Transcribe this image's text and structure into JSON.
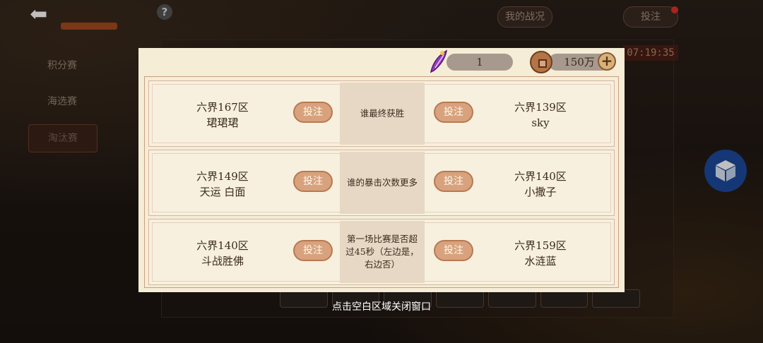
{
  "topbar": {
    "back_icon": "back-arrow-icon",
    "help_label": "?",
    "my_record_label": "我的战况",
    "bet_label": "投注"
  },
  "sidebar": {
    "items": [
      {
        "label": "积分赛",
        "active": false
      },
      {
        "label": "海选赛",
        "active": false
      },
      {
        "label": "淘汰赛",
        "active": true
      }
    ]
  },
  "timer": "07:19:35",
  "modal": {
    "resources": {
      "quill_count": "1",
      "coin_amount": "150万",
      "plus_label": "+"
    },
    "bet_button_label": "投注",
    "matches": [
      {
        "left_server": "六界167区",
        "left_player": "珺珺珺",
        "question": "谁最终获胜",
        "right_server": "六界139区",
        "right_player": "sky"
      },
      {
        "left_server": "六界149区",
        "left_player": "天运 白面",
        "question": "谁的暴击次数更多",
        "right_server": "六界140区",
        "right_player": "小撒子"
      },
      {
        "left_server": "六界140区",
        "left_player": "斗战胜佛",
        "question": "第一场比赛是否超过45秒（左边是，右边否）",
        "right_server": "六界159区",
        "right_player": "水涟蓝"
      }
    ]
  },
  "close_hint": "点击空白区域关闭窗口",
  "colors": {
    "modal_bg": "#f5edd6",
    "bet_button": "#d7a27d",
    "question_bg": "#e6d8c4"
  }
}
